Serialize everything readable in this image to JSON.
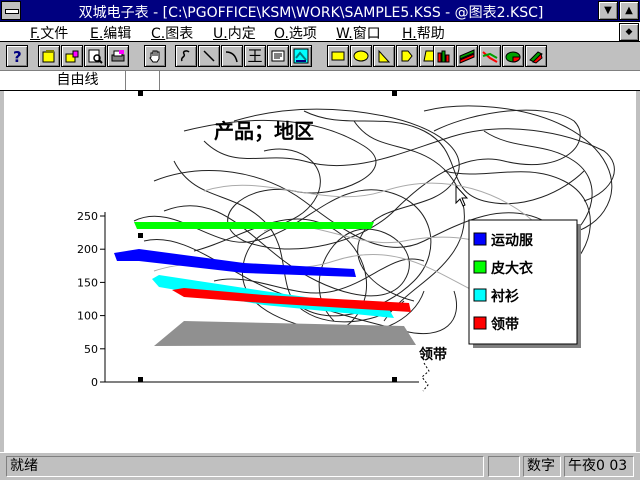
{
  "window": {
    "title": "双城电子表 - [C:\\PGOFFICE\\KSM\\WORK\\SAMPLE5.KSS - @图表2.KSC]"
  },
  "menu": [
    {
      "key": "F.",
      "label": "文件"
    },
    {
      "key": "E.",
      "label": "编辑"
    },
    {
      "key": "C.",
      "label": "图表"
    },
    {
      "key": "U.",
      "label": "内定"
    },
    {
      "key": "O.",
      "label": "选项"
    },
    {
      "key": "W.",
      "label": "窗口"
    },
    {
      "key": "H.",
      "label": "帮助"
    }
  ],
  "toolbar": {
    "text_tool_glyph": "王",
    "icons": [
      "help-icon",
      "open-icon",
      "save-icon",
      "print-preview-icon",
      "print-icon",
      "hand-icon",
      "freehand-icon",
      "line-icon",
      "arc-icon",
      "text-icon",
      "textbox-icon",
      "picture-icon",
      "rectangle-icon",
      "ellipse-icon",
      "triangle-icon",
      "pentagon-icon",
      "polygon-icon",
      "bar-chart-icon",
      "area-chart-icon",
      "line-chart-icon",
      "pie-chart-icon",
      "combo-chart-icon"
    ]
  },
  "editbar": {
    "mode": "自由线"
  },
  "chart_data": {
    "type": "bar",
    "title": "产品；地区",
    "yticks": [
      0,
      50,
      100,
      150,
      200,
      250
    ],
    "ylim": [
      0,
      250
    ],
    "series": [
      {
        "name": "运动服",
        "color": "#0000ff"
      },
      {
        "name": "皮大衣",
        "color": "#00ff00"
      },
      {
        "name": "衬衫",
        "color": "#00ffff"
      },
      {
        "name": "领带",
        "color": "#ff0000"
      }
    ],
    "legend": "right",
    "overflow_label": "领带"
  },
  "status": {
    "left": "就绪",
    "mode": "数字",
    "clock": "午夜0 03"
  }
}
